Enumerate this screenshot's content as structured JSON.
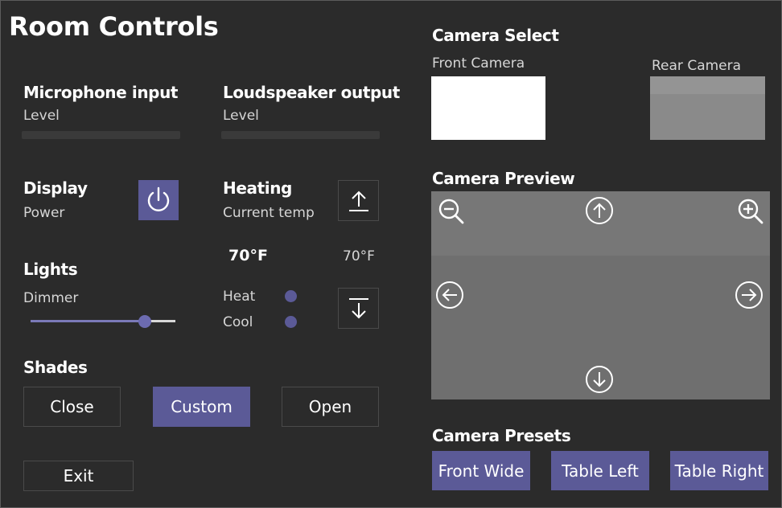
{
  "app": {
    "title": "Room Controls"
  },
  "microphone": {
    "title": "Microphone input",
    "level_label": "Level",
    "level": 0
  },
  "loudspeaker": {
    "title": "Loudspeaker output",
    "level_label": "Level",
    "level": 0
  },
  "display": {
    "title": "Display",
    "power_label": "Power",
    "power_icon": "power-icon"
  },
  "heating": {
    "title": "Heating",
    "current_label": "Current temp",
    "current_temp": "70°F",
    "set_temp": "70°F",
    "heat_label": "Heat",
    "cool_label": "Cool",
    "up_icon": "arrow-up-bar-icon",
    "down_icon": "arrow-down-bar-icon"
  },
  "lights": {
    "title": "Lights",
    "dimmer_label": "Dimmer",
    "dimmer_value": 0.82
  },
  "shades": {
    "title": "Shades",
    "buttons": [
      "Close",
      "Custom",
      "Open"
    ],
    "active": "Custom"
  },
  "exit_label": "Exit",
  "camera_select": {
    "title": "Camera Select",
    "front_label": "Front Camera",
    "rear_label": "Rear Camera"
  },
  "camera_preview": {
    "title": "Camera Preview",
    "icons": [
      "zoom-out-icon",
      "zoom-in-icon",
      "arrow-up-circle-icon",
      "arrow-down-circle-icon",
      "arrow-left-circle-icon",
      "arrow-right-circle-icon"
    ]
  },
  "camera_presets": {
    "title": "Camera Presets",
    "buttons": [
      "Front Wide",
      "Table Left",
      "Table Right"
    ]
  },
  "colors": {
    "background": "#2b2b2b",
    "accent": "#5b5a97",
    "panel_border": "#4a4a4a"
  }
}
